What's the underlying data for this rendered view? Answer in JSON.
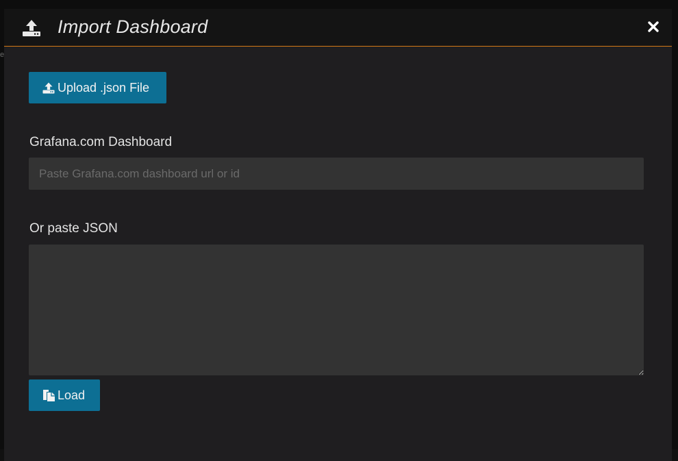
{
  "modal": {
    "title": "Import Dashboard",
    "header_icon": "upload-icon",
    "close_icon": "close-icon",
    "accent_color": "#d47a16"
  },
  "upload": {
    "label": "Upload .json File",
    "icon": "upload-icon",
    "color": "#0d6f94"
  },
  "grafana_com": {
    "label": "Grafana.com Dashboard",
    "value": "",
    "placeholder": "Paste Grafana.com dashboard url or id"
  },
  "json_paste": {
    "label": "Or paste JSON",
    "value": ""
  },
  "load": {
    "label": "Load",
    "icon": "clipboard-icon",
    "color": "#0d6f94"
  }
}
